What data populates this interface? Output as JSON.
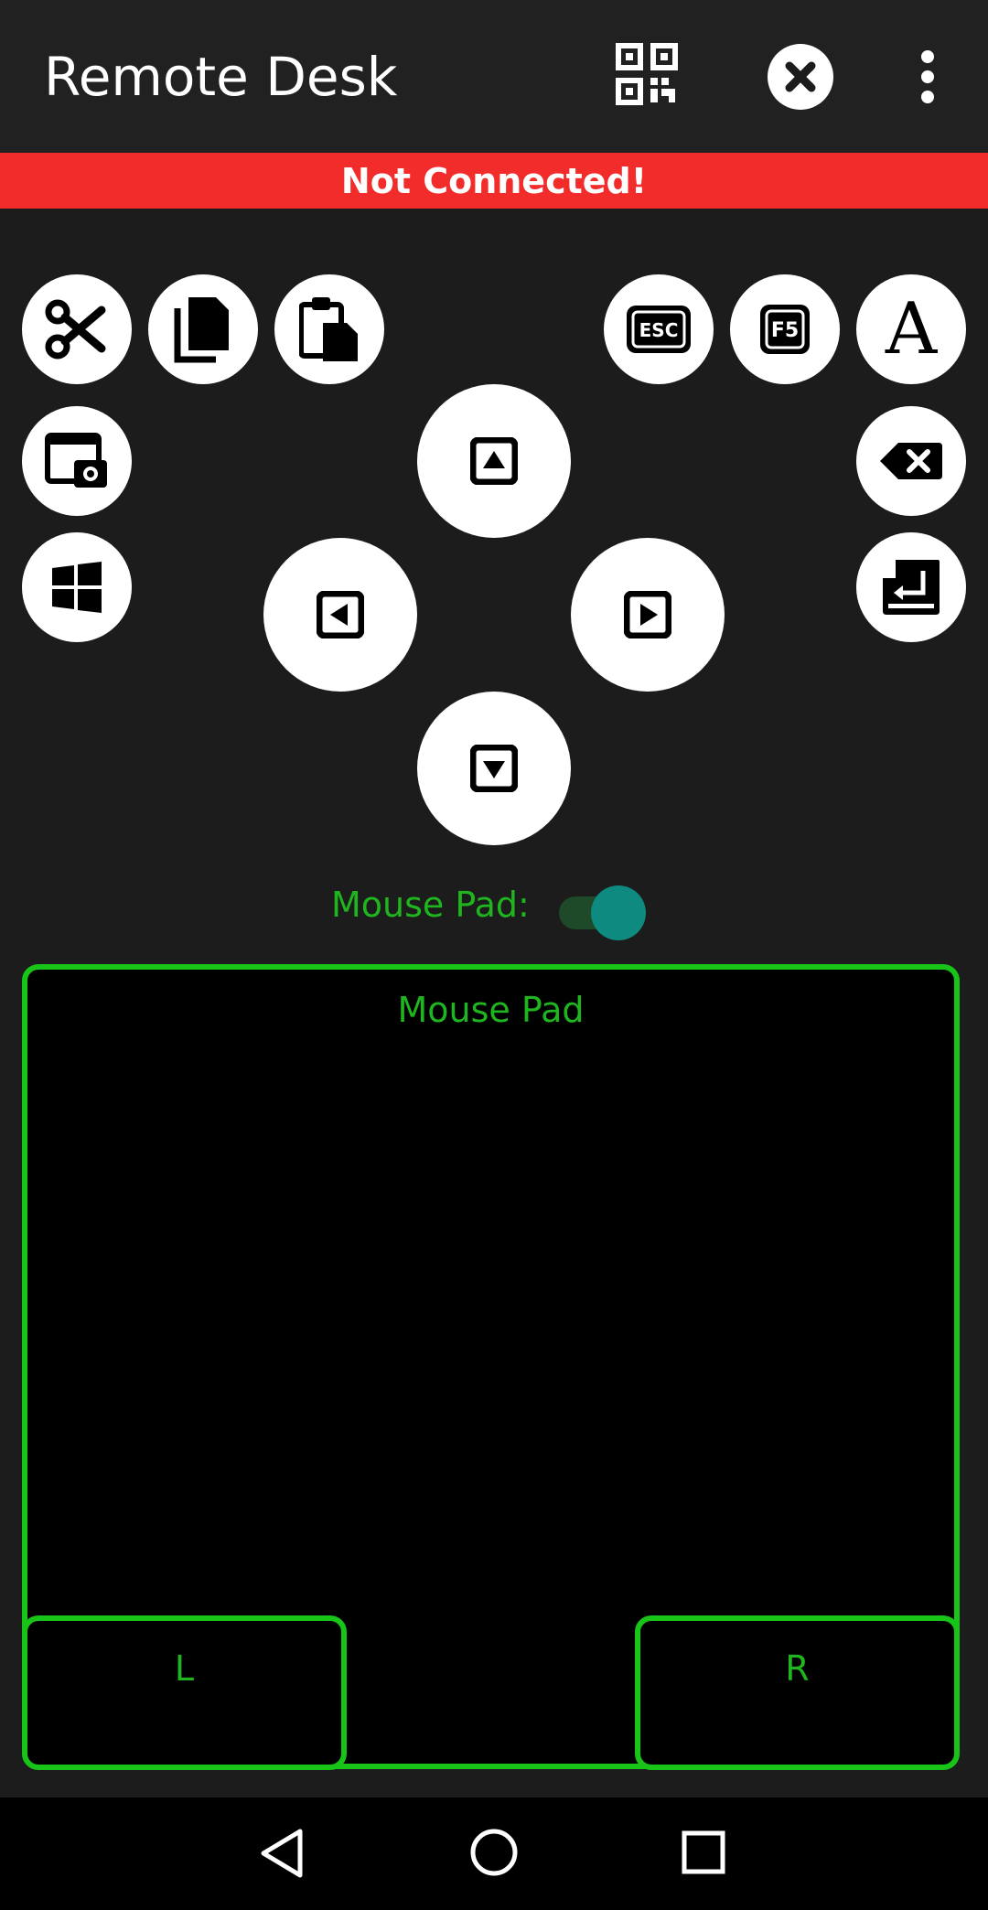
{
  "appbar": {
    "title": "Remote Desk",
    "icons": [
      "qr-code-icon",
      "close-icon",
      "more-vert-icon"
    ]
  },
  "status": {
    "text": "Not Connected!",
    "color": "#f22b2b"
  },
  "buttons": {
    "cut": "scissors-icon",
    "copy": "copy-icon",
    "paste": "paste-icon",
    "esc": "ESC",
    "f5": "F5",
    "font": "A",
    "screenshot": "screenshot-icon",
    "backspace": "backspace-icon",
    "windows": "windows-icon",
    "enter": "enter-icon"
  },
  "arrows": [
    "up-arrow-icon",
    "left-arrow-icon",
    "right-arrow-icon",
    "down-arrow-icon"
  ],
  "mouse_toggle": {
    "label": "Mouse Pad:",
    "on": true
  },
  "mouse_pad": {
    "title": "Mouse Pad",
    "left_label": "L",
    "right_label": "R",
    "accent": "#17c417"
  },
  "navbar": {
    "icons": [
      "back-icon",
      "home-icon",
      "recents-icon"
    ]
  }
}
